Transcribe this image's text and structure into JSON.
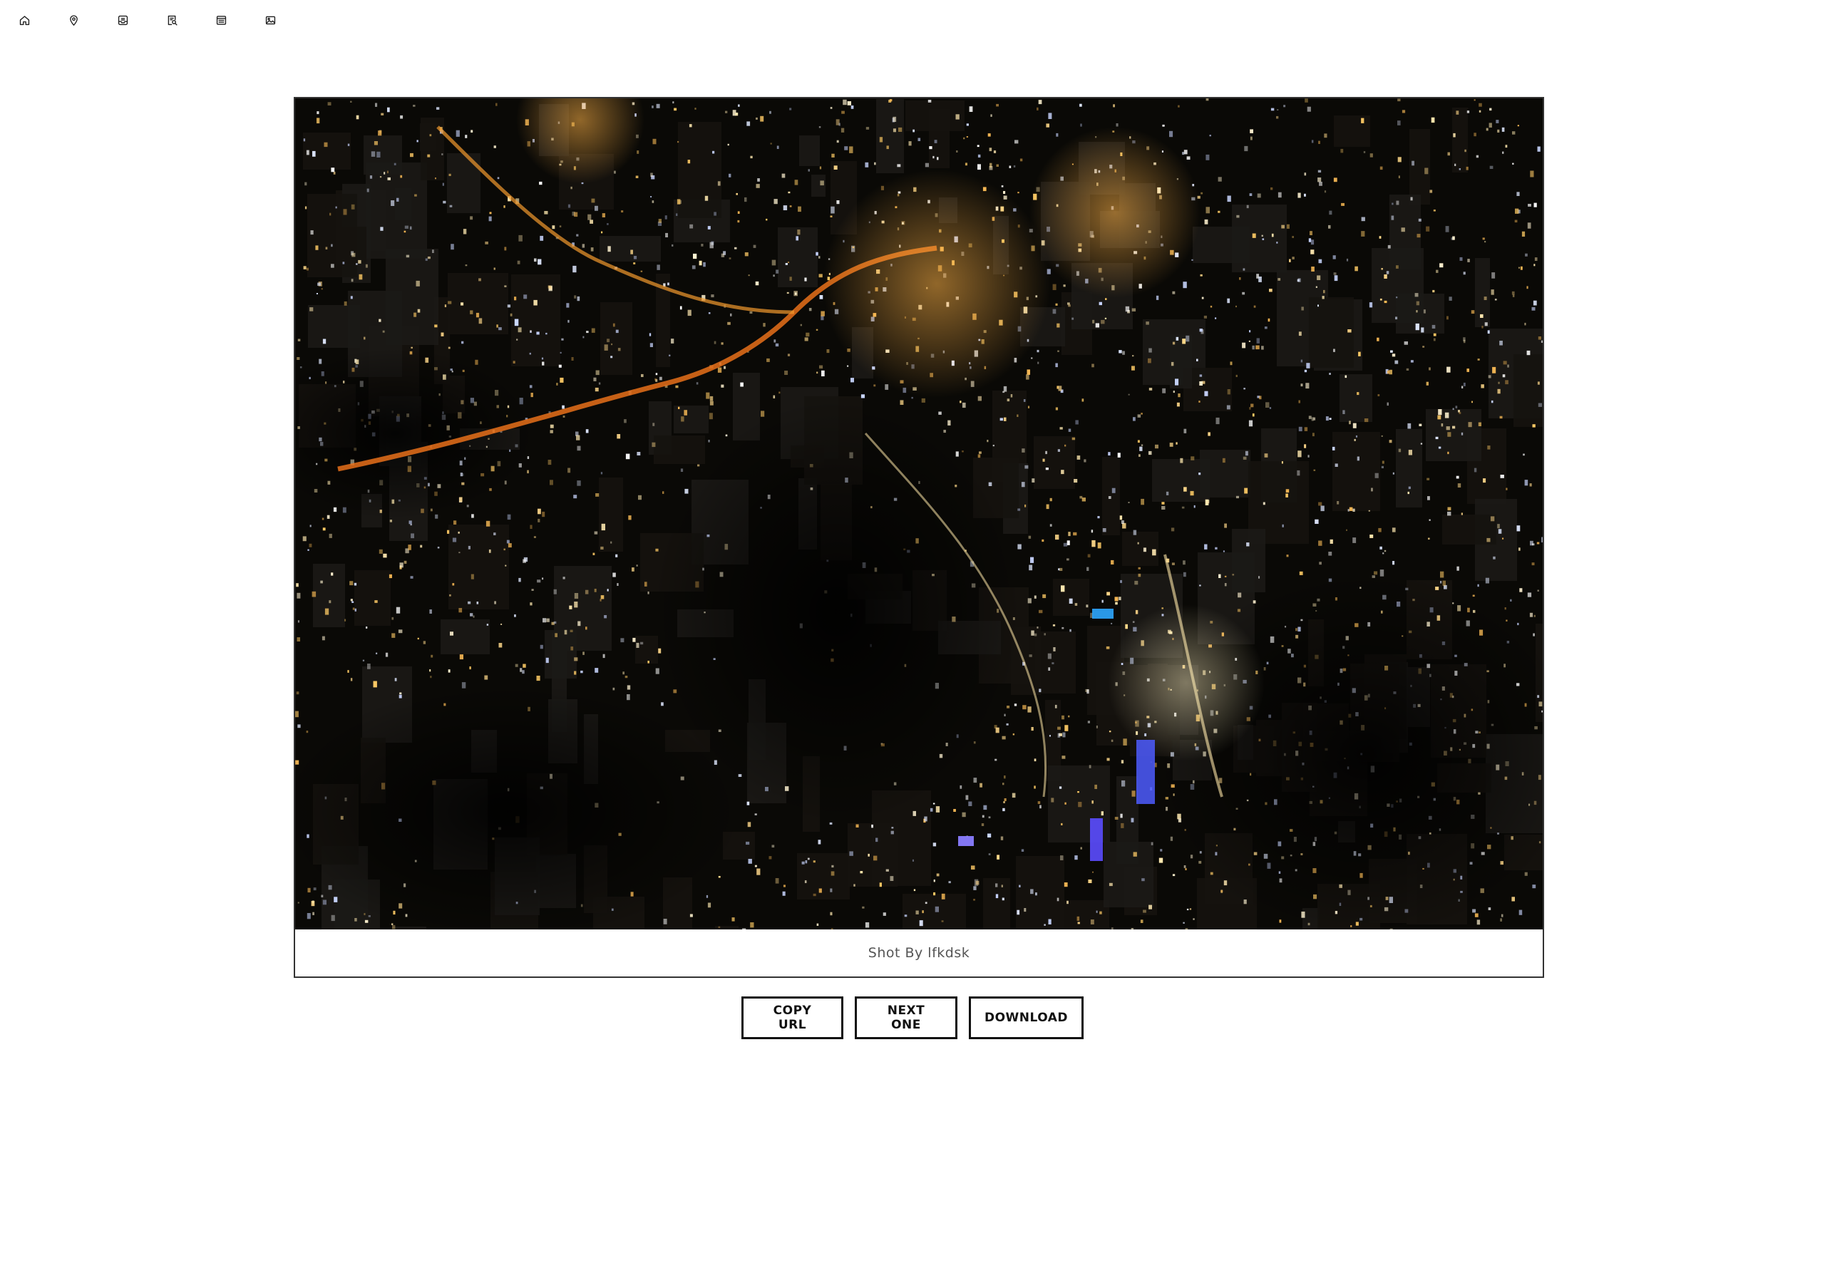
{
  "nav": {
    "items": [
      {
        "icon": "home-icon"
      },
      {
        "icon": "map-pin-icon"
      },
      {
        "icon": "inbox-icon"
      },
      {
        "icon": "search-document-icon"
      },
      {
        "icon": "newspaper-icon"
      },
      {
        "icon": "image-icon"
      }
    ]
  },
  "photo": {
    "caption": "Shot By lfkdsk"
  },
  "actions": {
    "copy_label": "COPY URL",
    "next_label": "NEXT ONE",
    "download_label": "DOWNLOAD"
  },
  "colors": {
    "border": "#333333",
    "button_border": "#111111",
    "caption_text": "#555555"
  }
}
